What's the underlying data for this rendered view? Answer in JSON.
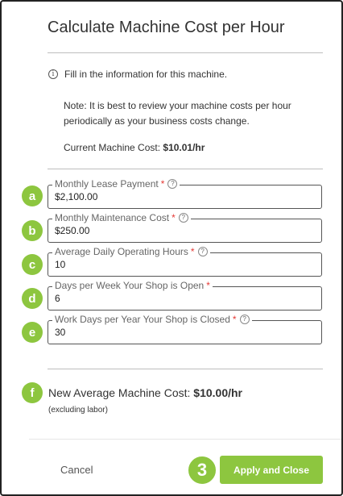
{
  "dialog": {
    "title": "Calculate Machine Cost per Hour",
    "info_icon": "info-circle-icon",
    "info_text": "Fill in the information for this machine.",
    "note": "Note: It is best to review your machine costs per hour periodically as your business costs change.",
    "current_label": "Current Machine Cost: ",
    "current_value": "$10.01/hr"
  },
  "fields": [
    {
      "badge": "a",
      "label": "Monthly Lease Payment",
      "required": "*",
      "help": "?",
      "value": "$2,100.00"
    },
    {
      "badge": "b",
      "label": "Monthly Maintenance Cost",
      "required": "*",
      "help": "?",
      "value": "$250.00"
    },
    {
      "badge": "c",
      "label": "Average Daily Operating Hours",
      "required": "*",
      "help": "?",
      "value": "10"
    },
    {
      "badge": "d",
      "label": "Days per Week Your Shop is Open",
      "required": "*",
      "value": "6"
    },
    {
      "badge": "e",
      "label": "Work Days per Year Your Shop is Closed",
      "required": "*",
      "help": "?",
      "value": "30"
    }
  ],
  "result": {
    "badge": "f",
    "label": "New Average Machine Cost: ",
    "value": "$10.00/hr",
    "sub": "(excluding labor)"
  },
  "footer": {
    "cancel_label": "Cancel",
    "apply_label": "Apply and Close",
    "step_badge": "3"
  },
  "colors": {
    "accent": "#8dc63f",
    "required": "#e53935"
  }
}
